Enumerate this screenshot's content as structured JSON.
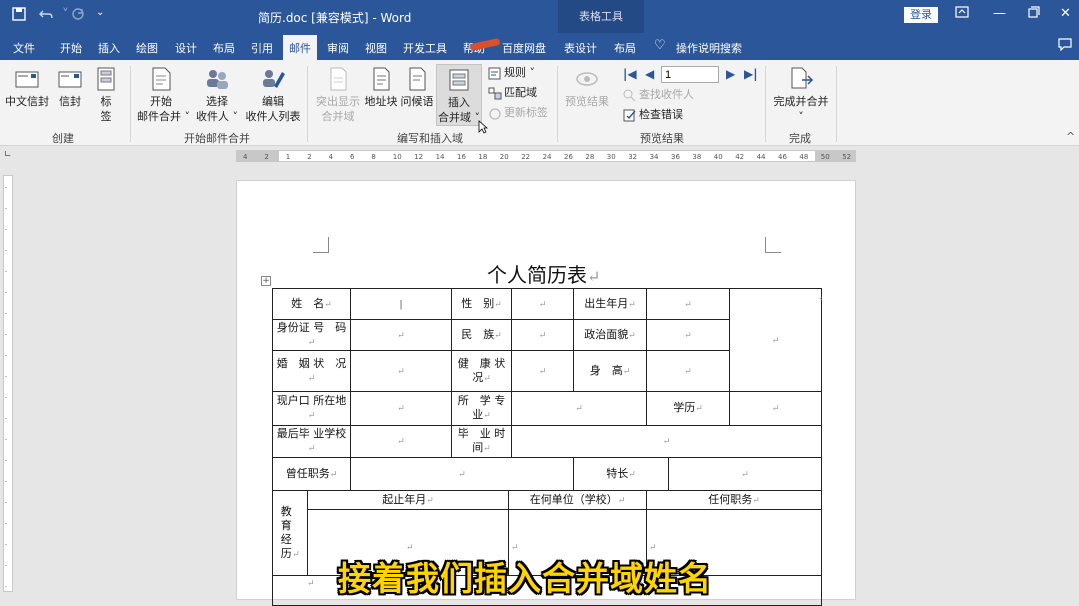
{
  "titlebar": {
    "save_icon": "save-icon",
    "undo_icon": "undo-icon",
    "redo_icon": "redo-icon",
    "qa_more_icon": "customize-quick-access-icon",
    "title": "简历.doc [兼容模式] - Word",
    "context_group": "表格工具",
    "login": "登录",
    "ribbon_display_icon": "ribbon-display-options-icon",
    "minimize_icon": "minimize-icon",
    "restore_icon": "restore-icon",
    "close_icon": "close-icon",
    "colors": {
      "titlebar": "#2b579a",
      "context": "#244a86"
    }
  },
  "tabs": [
    "文件",
    "开始",
    "插入",
    "绘图",
    "设计",
    "布局",
    "引用",
    "邮件",
    "审阅",
    "视图",
    "开发工具",
    "帮助",
    "百度网盘",
    "表设计",
    "布局"
  ],
  "active_tab": "邮件",
  "tell_me": "操作说明搜索",
  "share_icon": "share-comment-icon",
  "ribbon": {
    "create": {
      "label": "创建",
      "buttons": [
        "中文信封",
        "信封",
        "标签"
      ]
    },
    "start_merge": {
      "label": "开始邮件合并",
      "buttons": [
        {
          "line1": "开始",
          "line2": "邮件合并 ˅"
        },
        {
          "line1": "选择",
          "line2": "收件人 ˅"
        },
        {
          "line1": "编辑",
          "line2": "收件人列表"
        }
      ]
    },
    "write_insert": {
      "label": "编写和插入域",
      "buttons": [
        {
          "line1": "突出显示",
          "line2": "合并域",
          "disabled": true
        },
        {
          "line1": "地址块",
          "line2": "",
          "disabled": false
        },
        {
          "line1": "问候语",
          "line2": "",
          "disabled": false
        },
        {
          "line1": "插入",
          "line2": "合并域 ˅",
          "disabled": false
        }
      ],
      "small": [
        {
          "label": "规则 ˅",
          "disabled": false
        },
        {
          "label": "匹配域",
          "disabled": false
        },
        {
          "label": "更新标签",
          "disabled": true
        }
      ]
    },
    "preview": {
      "label": "预览结果",
      "button": "预览结果",
      "record": "1",
      "find": "查找收件人",
      "check": "检查错误"
    },
    "finish": {
      "label": "完成",
      "button": "完成并合并",
      "sub": "˅"
    }
  },
  "ruler": {
    "marks": [
      "4",
      "2",
      "1",
      "2",
      "4",
      "6",
      "8",
      "10",
      "12",
      "14",
      "16",
      "18",
      "20",
      "22",
      "24",
      "26",
      "28",
      "30",
      "32",
      "34",
      "36",
      "38",
      "40",
      "42",
      "44",
      "46",
      "48",
      "50",
      "52"
    ]
  },
  "document": {
    "title": "个人简历表",
    "return_mark": "↵",
    "rows": [
      [
        "姓　名",
        "",
        "性　别",
        "",
        "出生年月",
        ""
      ],
      [
        "身份证 号　码",
        "",
        "民　族",
        "",
        "政治面貌",
        ""
      ],
      [
        "婚　姻 状　况",
        "",
        "健　康 状　况",
        "",
        "身　高",
        ""
      ],
      [
        "现户口 所在地",
        "",
        "所　学 专　业",
        "",
        "学历",
        ""
      ],
      [
        "最后毕 业学校",
        "",
        "毕　业 时　间",
        ""
      ],
      [
        "曾任职务",
        "",
        "特长",
        ""
      ]
    ],
    "edu": {
      "label": "教 育 经 历",
      "headers": [
        "起止年月",
        "在何单位（学校）",
        "任何职务"
      ]
    }
  },
  "subtitle": "接着我们插入合并域姓名"
}
